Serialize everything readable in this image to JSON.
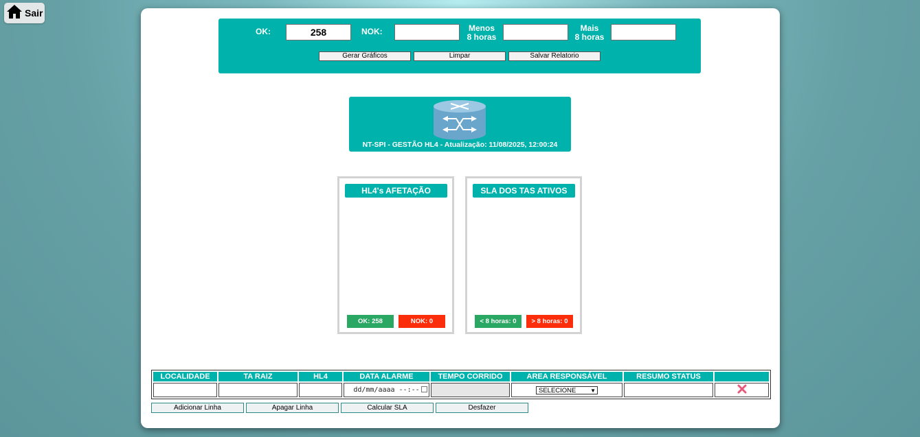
{
  "home": {
    "label": "Sair",
    "icon": "home-icon"
  },
  "summary": {
    "ok_label": "OK:",
    "ok_value": "258",
    "nok_label": "NOK:",
    "nok_value": "",
    "menos_label": "Menos\n8 horas",
    "menos_value": "",
    "mais_label": "Mais\n8 horas",
    "mais_value": ""
  },
  "actions": {
    "gerar": "Gerar Gráficos",
    "limpar": "Limpar",
    "salvar": "Salvar Relatorio"
  },
  "header": {
    "icon": "router-icon",
    "text": "NT-SPI - GESTÃO HL4 - Atualização: 11/08/2025, 12:00:24"
  },
  "cards": {
    "afetacao": {
      "title": "HL4's AFETAÇÃO",
      "ok_badge": "OK: 258",
      "nok_badge": "NOK: 0"
    },
    "sla": {
      "title": "SLA DOS TAS ATIVOS",
      "lt_badge": "< 8 horas: 0",
      "gt_badge": "> 8 horas: 0"
    }
  },
  "table": {
    "headers": [
      "LOCALIDADE",
      "TA RAIZ",
      "HL4",
      "DATA ALARME",
      "TEMPO CORRIDO",
      "AREA RESPONSÁVEL",
      "RESUMO STATUS",
      ""
    ],
    "date_placeholder": "dd/mm/aaaa --:--",
    "select_value": "SELECIONE",
    "delete_icon": "close-icon"
  },
  "bottom_buttons": {
    "add": "Adicionar Linha",
    "delete": "Apagar Linha",
    "calc": "Calcular SLA",
    "undo": "Desfazer"
  },
  "colors": {
    "teal": "#00b2ac",
    "ok_green": "#2aa763",
    "nok_red": "#fb2d0a",
    "delete_pink": "#e8587a"
  }
}
